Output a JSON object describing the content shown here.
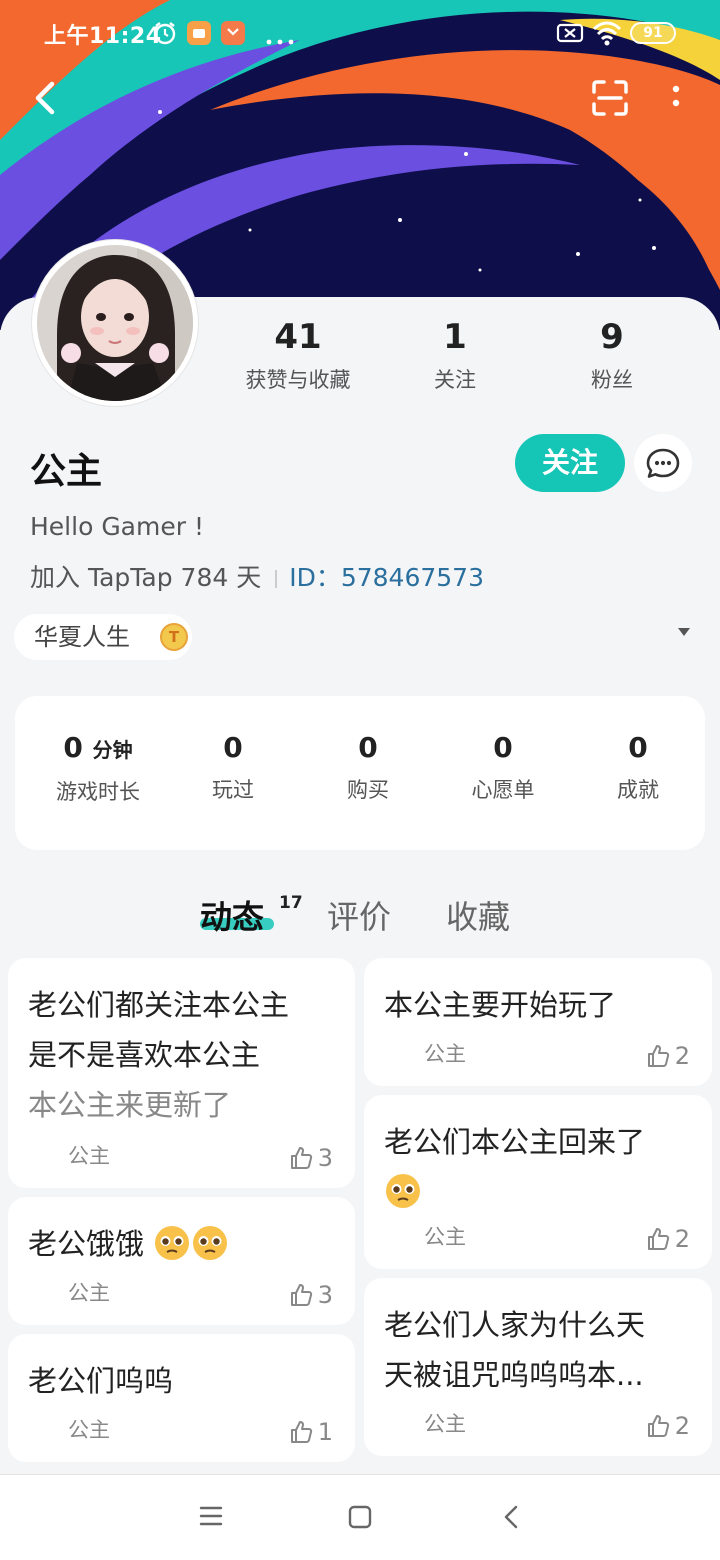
{
  "status_bar": {
    "time": "上午11:24",
    "battery": "91"
  },
  "profile": {
    "name": "公主",
    "bio": "Hello Gamer !",
    "join_text": "加入 TapTap 784 天",
    "id_text": "ID：578467573",
    "tag": "华夏人生",
    "tag_badge": "T"
  },
  "counts": [
    {
      "value": "41",
      "label": "获赞与收藏"
    },
    {
      "value": "1",
      "label": "关注"
    },
    {
      "value": "9",
      "label": "粉丝"
    }
  ],
  "actions": {
    "follow": "关注"
  },
  "game_stats": [
    {
      "value": "0",
      "unit": "分钟",
      "label": "游戏时长"
    },
    {
      "value": "0",
      "unit": "",
      "label": "玩过"
    },
    {
      "value": "0",
      "unit": "",
      "label": "购买"
    },
    {
      "value": "0",
      "unit": "",
      "label": "心愿单"
    },
    {
      "value": "0",
      "unit": "",
      "label": "成就"
    }
  ],
  "tabs": [
    {
      "label": "动态",
      "count": "17"
    },
    {
      "label": "评价"
    },
    {
      "label": "收藏"
    }
  ],
  "posts_left": [
    {
      "line1": "老公们都关注本公主",
      "line2": "是不是喜欢本公主",
      "line3": "本公主来更新了",
      "author": "公主",
      "likes": "3"
    },
    {
      "line1": "老公饿饿",
      "author": "公主",
      "likes": "3"
    },
    {
      "line1": "老公们呜呜",
      "author": "公主",
      "likes": "1"
    }
  ],
  "posts_right": [
    {
      "line1": "本公主要开始玩了",
      "author": "公主",
      "likes": "2"
    },
    {
      "line1": "老公们本公主回来了",
      "author": "公主",
      "likes": "2"
    },
    {
      "line1": "老公们人家为什么天",
      "line2": "天被诅咒呜呜呜本...",
      "author": "公主",
      "likes": "2"
    }
  ],
  "colors": {
    "accent": "#15c5b6",
    "banner_bg": "#0e0f4a",
    "link": "#2a6f9e"
  }
}
